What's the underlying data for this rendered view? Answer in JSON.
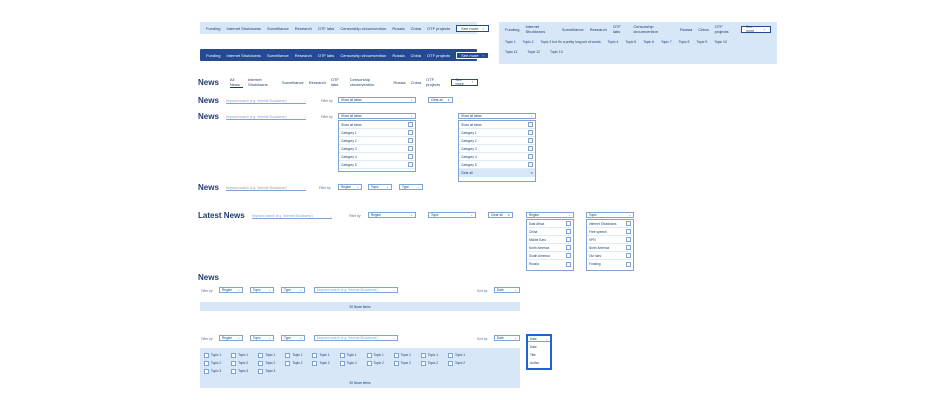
{
  "nav": {
    "items": [
      "Funding",
      "Internet Shutdowns",
      "Surveillance",
      "Research",
      "OTF labs",
      "Censorship circumvention",
      "Russia",
      "China",
      "OTF projects"
    ],
    "see_more": "See more"
  },
  "expanded": {
    "row1": [
      "Topic 1",
      "Topic 2",
      "Topic 3 but it's a pretty long set of words",
      "Topic 4",
      "Topic 5",
      "Topic 6",
      "Topic 7",
      "Topic 8",
      "Topic 9",
      "Topic 10"
    ],
    "row2": [
      "Topic 11",
      "Topic 12",
      "Topic 13"
    ]
  },
  "news_nav": {
    "title": "News",
    "items": [
      "All News",
      "Internet Shutdowns",
      "Surveillance",
      "Research",
      "OTF labs",
      "Censorship circumvention",
      "Russia",
      "China",
      "OTF projects"
    ],
    "see_more": "See more"
  },
  "filters": {
    "search_placeholder": "Keyword search (e.g. 'Internet Shutdowns')",
    "filter_by": "Filter by:",
    "sort_by": "Sort by:",
    "show_all_ideas": "Show all ideas",
    "clear_all": "Clear all",
    "category_options": [
      "Show all ideas",
      "Category 1",
      "Category 2",
      "Category 3",
      "Category 4",
      "Category 5",
      "Really really long category name 6"
    ],
    "region": "Region",
    "topic": "Topic",
    "type": "Type",
    "date": "Date"
  },
  "latest": {
    "title": "Latest News",
    "regions": [
      "East Africa",
      "China",
      "Middle East",
      "North America",
      "South America",
      "Russia"
    ],
    "topics": [
      "Internet Shutdowns",
      "Free speech",
      "VPN",
      "North America",
      "Our labs",
      "Funding"
    ]
  },
  "news2": {
    "title": "News",
    "count": "50 News Items",
    "topic_rows": [
      [
        "Topic 1",
        "Topic 1",
        "Topic 1",
        "Topic 1",
        "Topic 1",
        "Topic 1",
        "Topic 1",
        "Topic 1",
        "Topic 1",
        "Topic 1"
      ],
      [
        "Topic 2",
        "Topic 2",
        "Topic 2",
        "Topic 2",
        "Topic 2",
        "Topic 2",
        "Topic 2",
        "Topic 2",
        "Topic 2",
        "Topic 2"
      ],
      [
        "Topic 3",
        "Topic 3",
        "Topic 3"
      ]
    ],
    "sort_options": [
      "Date",
      "Title",
      "Author"
    ]
  }
}
